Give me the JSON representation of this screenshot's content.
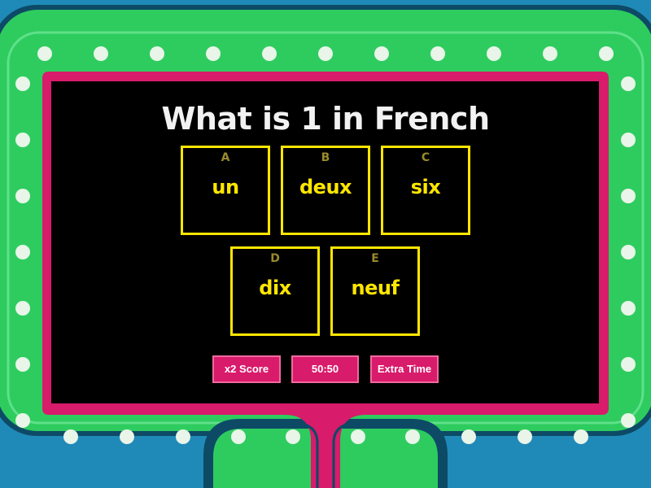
{
  "game": {
    "question": "What is 1 in French",
    "answers": [
      {
        "letter": "A",
        "text": "un"
      },
      {
        "letter": "B",
        "text": "deux"
      },
      {
        "letter": "C",
        "text": "six"
      },
      {
        "letter": "D",
        "text": "dix"
      },
      {
        "letter": "E",
        "text": "neuf"
      }
    ],
    "powerups": [
      {
        "label": "x2 Score"
      },
      {
        "label": "50:50"
      },
      {
        "label": "Extra Time"
      }
    ]
  },
  "colors": {
    "background_blue": "#1f8ab8",
    "frame_green": "#2ecc5f",
    "frame_dark": "#0d4a66",
    "marquee_light": "#e8f5e8",
    "screen_border": "#d81b6b",
    "screen_bg": "#000000",
    "question_text": "#f2f2f2",
    "answer_text": "#ffe600",
    "card_border": "#ffe600",
    "powerup_bg": "#d81b6b"
  }
}
